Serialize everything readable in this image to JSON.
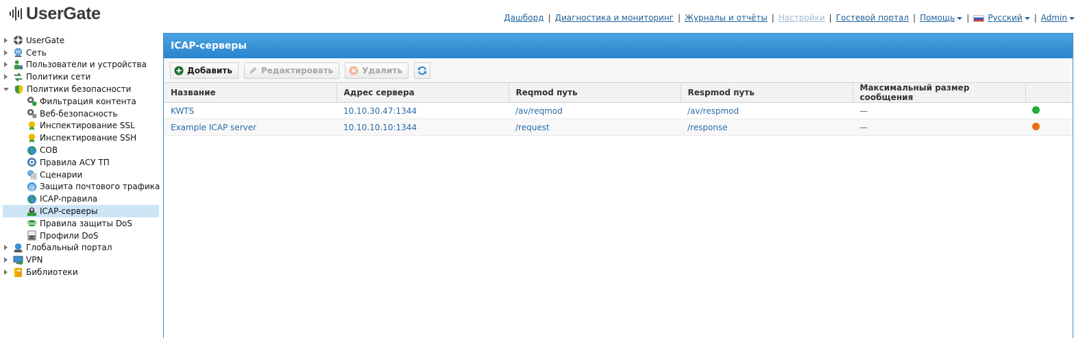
{
  "app": {
    "logo_text": "UserGate"
  },
  "topnav": {
    "items": [
      {
        "label": "Дашборд"
      },
      {
        "label": "Диагностика и мониторинг"
      },
      {
        "label": "Журналы и отчёты"
      },
      {
        "label": "Настройки",
        "disabled": true
      },
      {
        "label": "Гостевой портал"
      },
      {
        "label": "Помощь"
      },
      {
        "label": "Русский"
      },
      {
        "label": "Admin"
      }
    ]
  },
  "sidebar": {
    "items": [
      {
        "label": "UserGate",
        "icon": "usergate-icon"
      },
      {
        "label": "Сеть",
        "icon": "network-icon"
      },
      {
        "label": "Пользователи и устройства",
        "icon": "users-icon"
      },
      {
        "label": "Политики сети",
        "icon": "network-policy-icon"
      },
      {
        "label": "Политики безопасности",
        "icon": "security-shield-icon"
      },
      {
        "label": "Фильтрация контента",
        "icon": "content-filter-icon"
      },
      {
        "label": "Веб-безопасность",
        "icon": "web-security-icon"
      },
      {
        "label": "Инспектирование SSL",
        "icon": "certificate-icon"
      },
      {
        "label": "Инспектирование SSH",
        "icon": "certificate-icon"
      },
      {
        "label": "СОВ",
        "icon": "globe-icon"
      },
      {
        "label": "Правила АСУ ТП",
        "icon": "scada-icon"
      },
      {
        "label": "Сценарии",
        "icon": "scenario-icon"
      },
      {
        "label": "Защита почтового трафика",
        "icon": "at-mail-icon"
      },
      {
        "label": "ICAP-правила",
        "icon": "globe-icon"
      },
      {
        "label": "ICAP-серверы",
        "icon": "icap-server-icon"
      },
      {
        "label": "Правила защиты DoS",
        "icon": "dos-icon"
      },
      {
        "label": "Профили DoS",
        "icon": "dos-profile-icon"
      },
      {
        "label": "Глобальный портал",
        "icon": "portal-icon"
      },
      {
        "label": "VPN",
        "icon": "vpn-icon"
      },
      {
        "label": "Библиотеки",
        "icon": "library-icon"
      }
    ]
  },
  "panel": {
    "title": "ICAP-серверы",
    "toolbar": {
      "add_label": "Добавить",
      "edit_label": "Редактировать",
      "delete_label": "Удалить"
    },
    "columns": [
      "Название",
      "Адрес сервера",
      "Reqmod путь",
      "Respmod путь",
      "Максимальный размер сообщения",
      ""
    ],
    "rows": [
      {
        "name": "KWTS",
        "address": "10.10.30.47:1344",
        "reqmod": "/av/reqmod",
        "respmod": "/av/respmod",
        "max_size": "—",
        "status_color": "#1fae3a"
      },
      {
        "name": "Example ICAP server",
        "address": "10.10.10.10:1344",
        "reqmod": "/request",
        "respmod": "/response",
        "max_size": "—",
        "status_color": "#f06a12"
      }
    ]
  },
  "colors": {
    "accent": "#2a84cd",
    "link": "#1a5e9a",
    "selected_row": "#cde4f5"
  }
}
